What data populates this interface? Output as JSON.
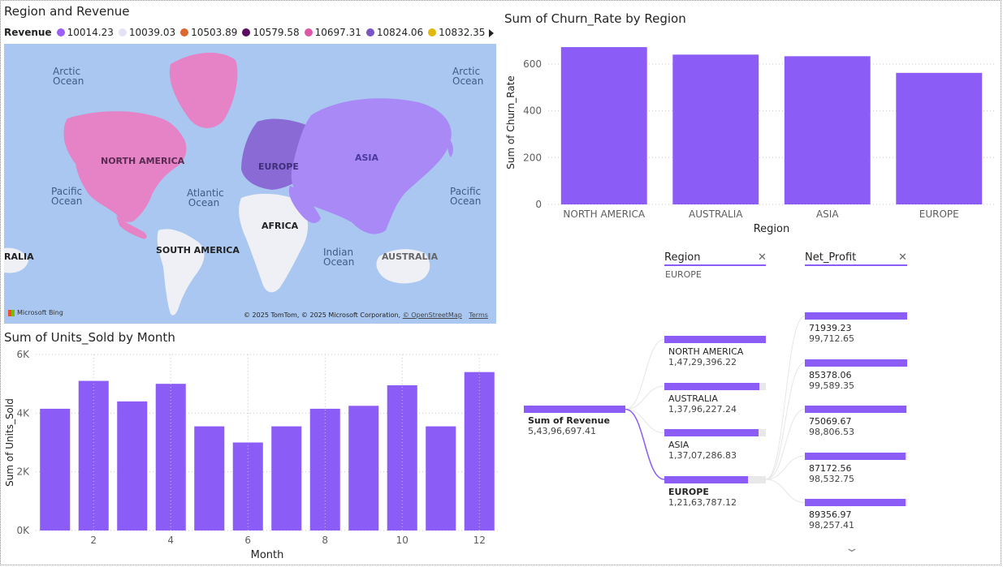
{
  "map": {
    "title": "Region and Revenue",
    "legend_label": "Revenue",
    "legend": [
      {
        "value": "10014.23",
        "color": "#9b61f5"
      },
      {
        "value": "10039.03",
        "color": "#e6e1f6"
      },
      {
        "value": "10503.89",
        "color": "#e0652f"
      },
      {
        "value": "10579.58",
        "color": "#5a0a60"
      },
      {
        "value": "10697.31",
        "color": "#e057a8"
      },
      {
        "value": "10824.06",
        "color": "#7a55c4"
      },
      {
        "value": "10832.35",
        "color": "#e2b80c"
      }
    ],
    "more_icon": "triangle-right-icon",
    "labels": {
      "arctic_left": "Arctic Ocean",
      "arctic_right": "Arctic Ocean",
      "north_america": "NORTH AMERICA",
      "europe": "EUROPE",
      "asia": "ASIA",
      "pacific_left": "Pacific Ocean",
      "pacific_right": "Pacific Ocean",
      "atlantic": "Atlantic Ocean",
      "africa": "AFRICA",
      "south_america": "SOUTH AMERICA",
      "indian": "Indian Ocean",
      "australia": "AUSTRALIA",
      "ralia": "RALIA"
    },
    "bing": "Microsoft Bing",
    "attribution": "© 2025 TomTom, © 2025 Microsoft Corporation,",
    "osm": "© OpenStreetMap",
    "terms": "Terms"
  },
  "chart_data": [
    {
      "type": "bar",
      "title": "Sum of Churn_Rate by Region",
      "xlabel": "Region",
      "ylabel": "Sum of Churn_Rate",
      "categories": [
        "NORTH AMERICA",
        "AUSTRALIA",
        "ASIA",
        "EUROPE"
      ],
      "values": [
        672,
        640,
        633,
        562
      ],
      "ylim": [
        0,
        700
      ],
      "yticks": [
        0,
        200,
        400,
        600
      ],
      "ytick_labels": [
        "0",
        "200",
        "400",
        "600"
      ],
      "color": "#8b5cf6",
      "grid": true
    },
    {
      "type": "bar",
      "title": "Sum of Units_Sold by Month",
      "xlabel": "Month",
      "ylabel": "Sum of Units_Sold",
      "categories": [
        "1",
        "2",
        "3",
        "4",
        "5",
        "6",
        "7",
        "8",
        "9",
        "10",
        "11",
        "12"
      ],
      "xtick_labels": [
        "",
        "2",
        "",
        "4",
        "",
        "6",
        "",
        "8",
        "",
        "10",
        "",
        "12"
      ],
      "values": [
        4150,
        5100,
        4400,
        5000,
        3550,
        3000,
        3550,
        4150,
        4250,
        4950,
        3550,
        5400
      ],
      "ylim": [
        0,
        6000
      ],
      "yticks": [
        0,
        2000,
        4000,
        6000
      ],
      "ytick_labels": [
        "0K",
        "2K",
        "4K",
        "6K"
      ],
      "color": "#8b5cf6",
      "grid": true
    },
    {
      "type": "decomposition_tree",
      "levels": [
        "Region",
        "Net_Profit"
      ],
      "selected_region": "EUROPE",
      "root": {
        "label": "Sum of Revenue",
        "value": "5,43,96,697.41"
      },
      "regions": [
        {
          "name": "NORTH AMERICA",
          "value": "1,47,29,396.22",
          "fraction": 1.0
        },
        {
          "name": "AUSTRALIA",
          "value": "1,37,96,227.24",
          "fraction": 0.937
        },
        {
          "name": "ASIA",
          "value": "1,37,07,286.83",
          "fraction": 0.93
        },
        {
          "name": "EUROPE",
          "value": "1,21,63,787.12",
          "fraction": 0.826
        }
      ],
      "net_profit": [
        {
          "name": "71939.23",
          "value": "99,712.65",
          "fraction": 1.0
        },
        {
          "name": "85378.06",
          "value": "99,589.35",
          "fraction": 0.999
        },
        {
          "name": "75069.67",
          "value": "98,806.53",
          "fraction": 0.991
        },
        {
          "name": "87172.56",
          "value": "98,532.75",
          "fraction": 0.988
        },
        {
          "name": "89356.97",
          "value": "98,257.41",
          "fraction": 0.985
        }
      ]
    }
  ],
  "icons": {
    "close": "close-icon",
    "chevron": "chevron-down-icon",
    "bing": "bing-logo-icon"
  }
}
